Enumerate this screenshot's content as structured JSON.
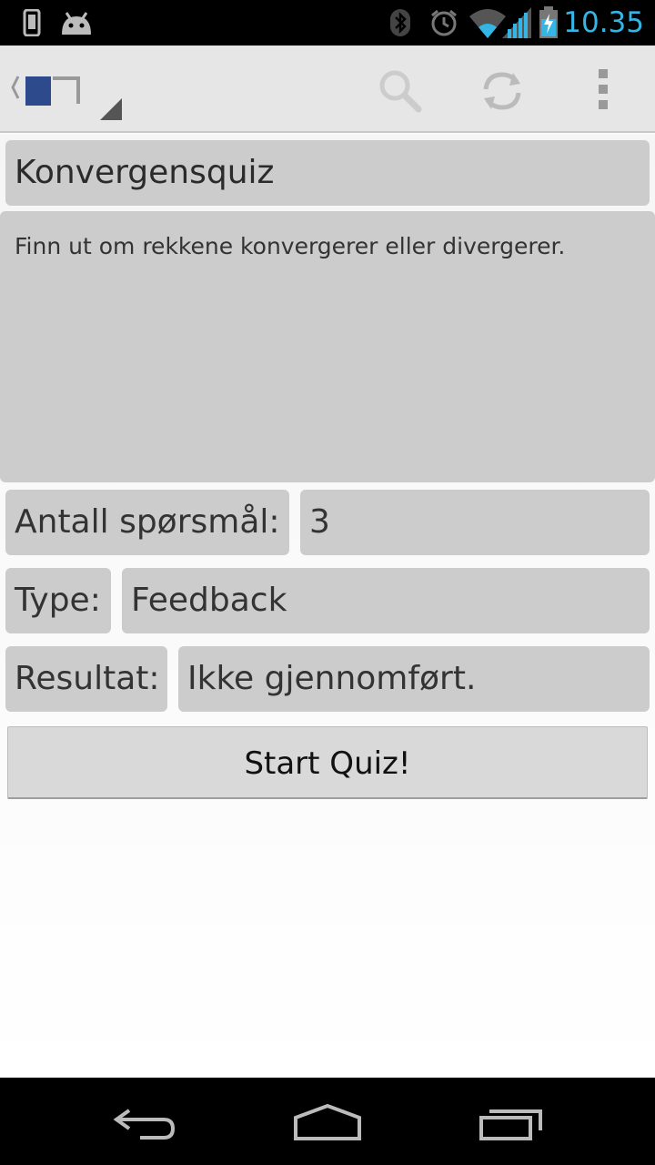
{
  "status_bar": {
    "time": "10.35",
    "icons": [
      "phone-icon",
      "android-icon",
      "bluetooth-icon",
      "alarm-icon",
      "wifi-icon",
      "signal-icon",
      "battery-charging-icon"
    ]
  },
  "action_bar": {
    "icons": [
      "app-logo-icon",
      "search-icon",
      "refresh-icon",
      "overflow-menu-icon"
    ]
  },
  "quiz": {
    "title": "Konvergensquiz",
    "description": "Finn ut om rekkene konvergerer eller divergerer.",
    "count_label": "Antall spørsmål:",
    "count_value": "3",
    "type_label": "Type:",
    "type_value": "Feedback",
    "result_label": "Resultat:",
    "result_value": "Ikke gjennomført.",
    "start_button": "Start Quiz!"
  },
  "nav_bar": {
    "icons": [
      "back-icon",
      "home-icon",
      "recent-apps-icon"
    ]
  },
  "colors": {
    "accent": "#33b5e5",
    "box": "#cccccc",
    "actionbar": "#e6e6e6"
  }
}
